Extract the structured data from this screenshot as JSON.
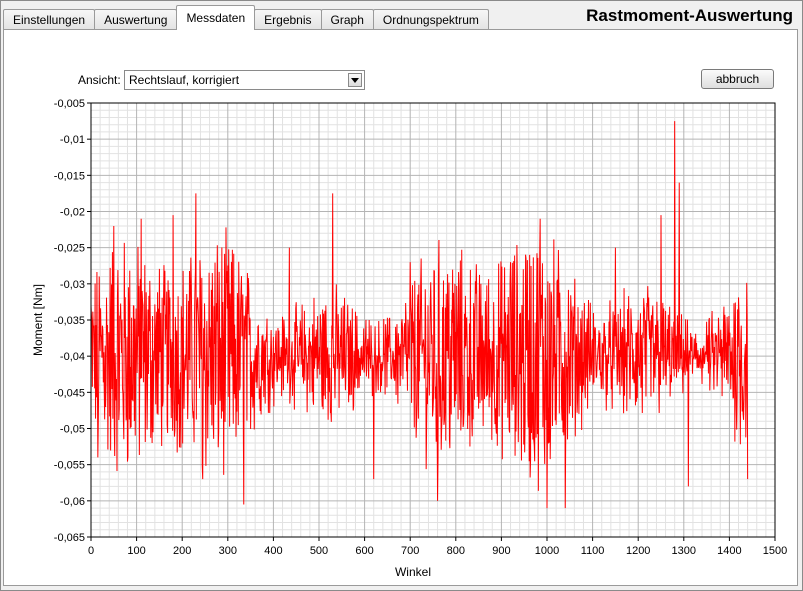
{
  "tabs": [
    {
      "label": "Einstellungen",
      "active": false
    },
    {
      "label": "Auswertung",
      "active": false
    },
    {
      "label": "Messdaten",
      "active": true
    },
    {
      "label": "Ergebnis",
      "active": false
    },
    {
      "label": "Graph",
      "active": false
    },
    {
      "label": "Ordnungspektrum",
      "active": false
    }
  ],
  "app_title": "Rastmoment-Auswertung",
  "view": {
    "label": "Ansicht:",
    "selected": "Rechtslauf, korrigiert"
  },
  "abort_label": "abbruch",
  "colors": {
    "series": "#ff0000",
    "grid_major": "#b4b4b4",
    "grid_minor": "#e2e2e2"
  },
  "chart_data": {
    "type": "line",
    "xlabel": "Winkel",
    "ylabel": "Moment [Nm]",
    "xlim": [
      0,
      1500
    ],
    "ylim": [
      -0.065,
      -0.005
    ],
    "x_ticks": [
      "0",
      "100",
      "200",
      "300",
      "400",
      "500",
      "600",
      "700",
      "800",
      "900",
      "1000",
      "1100",
      "1200",
      "1300",
      "1400",
      "1500"
    ],
    "y_ticks": [
      "-0,005",
      "-0,01",
      "-0,015",
      "-0,02",
      "-0,025",
      "-0,03",
      "-0,035",
      "-0,04",
      "-0,045",
      "-0,05",
      "-0,055",
      "-0,06",
      "-0,065"
    ],
    "grid": true,
    "series": [
      {
        "color": "#ff0000",
        "x_range": [
          0,
          1440
        ],
        "mean": -0.04,
        "max": -0.0075,
        "min": -0.061,
        "anchor_points": [
          [
            0,
            -0.033
          ],
          [
            15,
            -0.054
          ],
          [
            50,
            -0.022
          ],
          [
            110,
            -0.021
          ],
          [
            180,
            -0.0205
          ],
          [
            230,
            -0.0175
          ],
          [
            245,
            -0.057
          ],
          [
            335,
            -0.0605
          ],
          [
            435,
            -0.025
          ],
          [
            530,
            -0.0175
          ],
          [
            620,
            -0.057
          ],
          [
            700,
            -0.027
          ],
          [
            760,
            -0.06
          ],
          [
            920,
            -0.027
          ],
          [
            985,
            -0.021
          ],
          [
            1000,
            -0.061
          ],
          [
            1040,
            -0.061
          ],
          [
            1150,
            -0.025
          ],
          [
            1250,
            -0.0205
          ],
          [
            1280,
            -0.0075
          ],
          [
            1290,
            -0.016
          ],
          [
            1310,
            -0.058
          ],
          [
            1440,
            -0.057
          ]
        ]
      }
    ]
  }
}
